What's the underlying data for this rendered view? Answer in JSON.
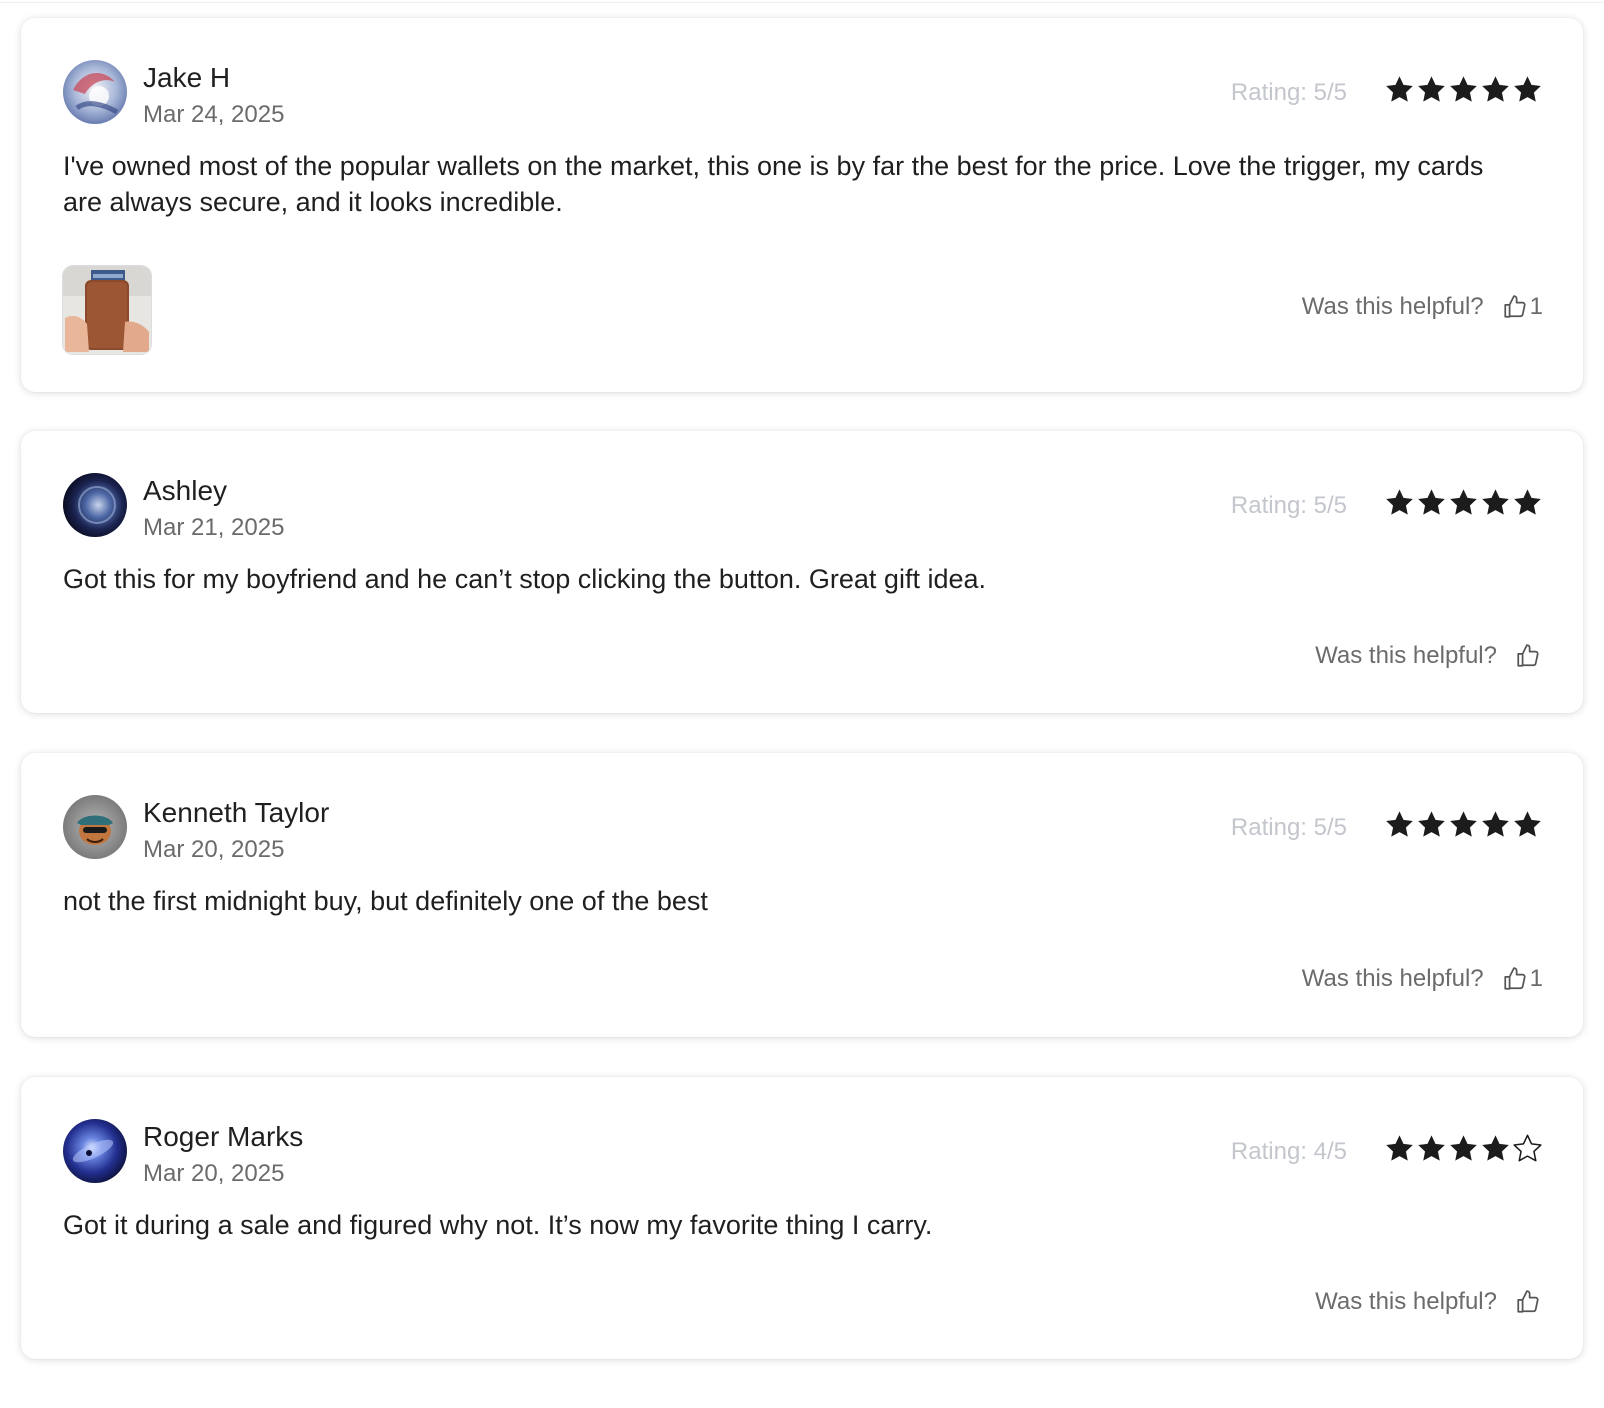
{
  "reviews": [
    {
      "name": "Jake H",
      "date": "Mar 24, 2025",
      "rating_label": "Rating: 5/5",
      "rating": 5,
      "body": "I've owned most of the popular wallets on the market, this one is by far the best for the price. Love the trigger, my cards are always secure, and it looks incredible.",
      "has_photo": true,
      "helpful_label": "Was this helpful?",
      "helpful_count": "1"
    },
    {
      "name": "Ashley",
      "date": "Mar 21, 2025",
      "rating_label": "Rating: 5/5",
      "rating": 5,
      "body": "Got this for my boyfriend and he can’t stop clicking the button. Great gift idea.",
      "has_photo": false,
      "helpful_label": "Was this helpful?",
      "helpful_count": ""
    },
    {
      "name": "Kenneth Taylor",
      "date": "Mar 20, 2025",
      "rating_label": "Rating: 5/5",
      "rating": 5,
      "body": "not the first midnight buy, but definitely one of the best",
      "has_photo": false,
      "helpful_label": "Was this helpful?",
      "helpful_count": "1"
    },
    {
      "name": "Roger Marks",
      "date": "Mar 20, 2025",
      "rating_label": "Rating: 4/5",
      "rating": 4,
      "body": "Got it during a sale and figured why not. It’s now my favorite thing I carry.",
      "has_photo": false,
      "helpful_label": "Was this helpful?",
      "helpful_count": ""
    }
  ],
  "icons": {
    "star": "star-icon",
    "thumbs_up": "thumbs-up-icon"
  },
  "colors": {
    "star_fill": "#1c1c1c",
    "rating_text": "#c3c6cc",
    "muted_text": "#6b6b6b"
  }
}
